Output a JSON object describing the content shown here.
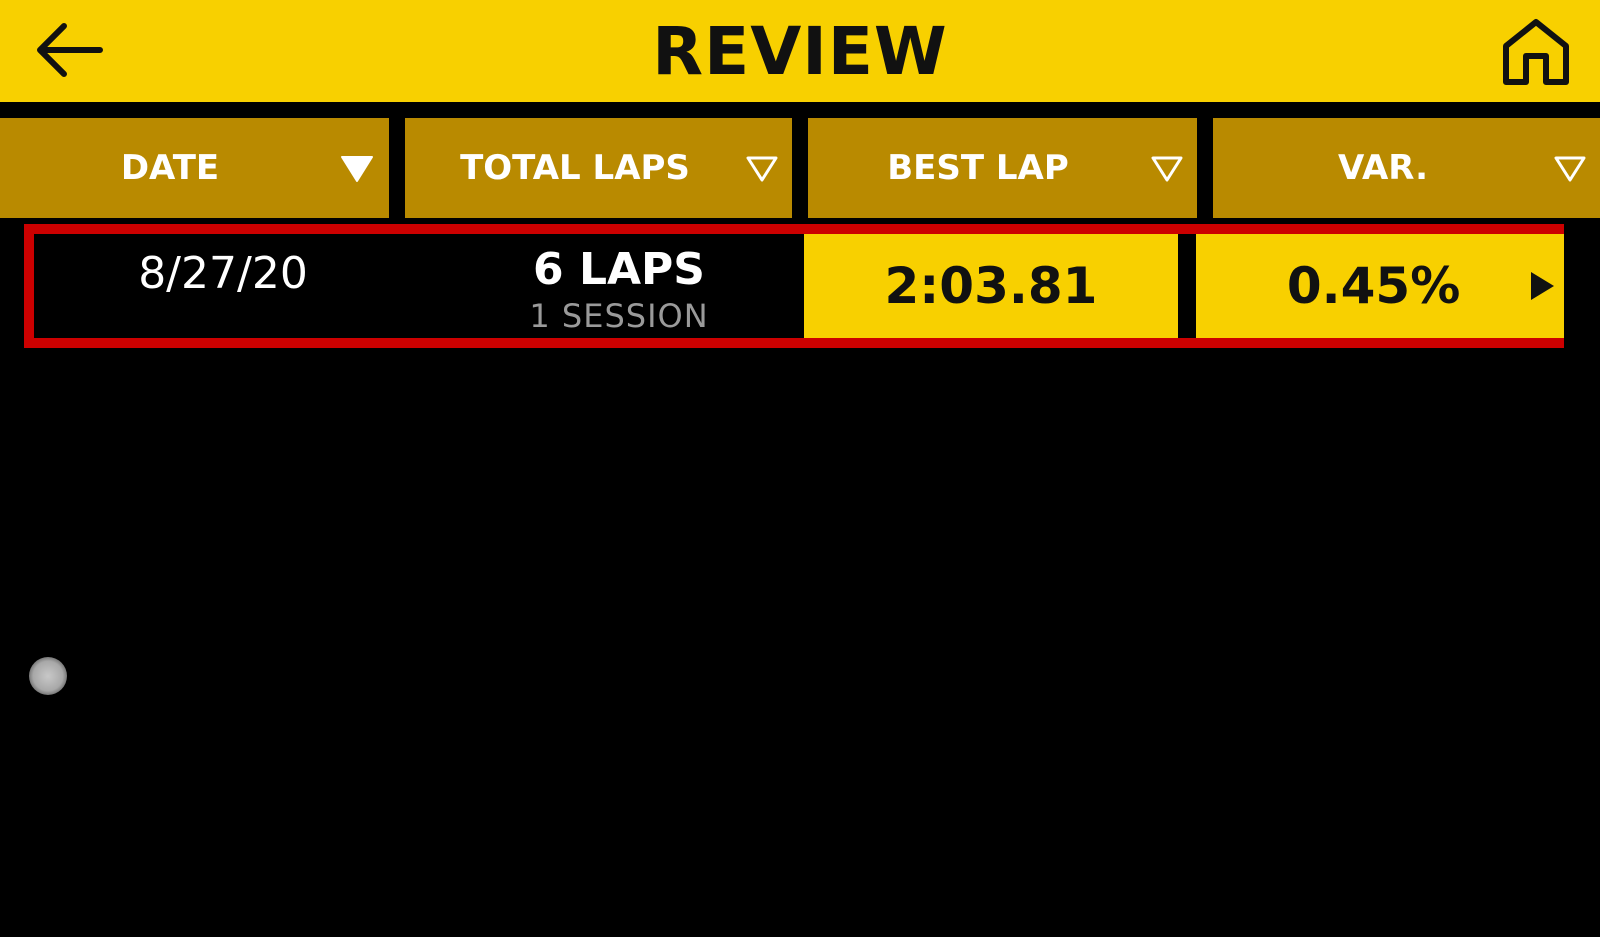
{
  "header": {
    "title": "REVIEW",
    "back_icon": "arrow-left-icon",
    "home_icon": "home-icon"
  },
  "columns": [
    {
      "label": "DATE",
      "sort_icon": "triangle-down-filled-icon"
    },
    {
      "label": "TOTAL LAPS",
      "sort_icon": "triangle-down-outline-icon"
    },
    {
      "label": "BEST LAP",
      "sort_icon": "triangle-down-outline-icon"
    },
    {
      "label": "VAR.",
      "sort_icon": "triangle-down-outline-icon"
    }
  ],
  "rows": [
    {
      "date": "8/27/20",
      "total_laps": "6 LAPS",
      "sessions": "1 SESSION",
      "best_lap": "2:03.81",
      "variance": "0.45%",
      "arrow_icon": "play-arrow-icon"
    }
  ],
  "colors": {
    "header_yellow": "#f8d000",
    "column_header_gold": "#b98a00",
    "selection_red": "#cc0000",
    "background": "#000000"
  }
}
